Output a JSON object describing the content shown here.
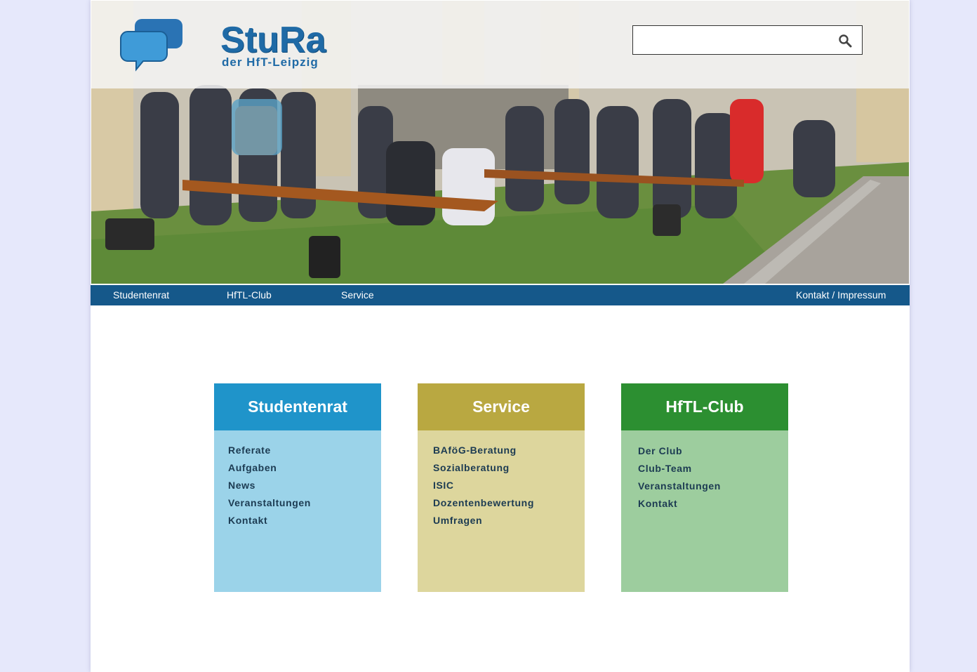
{
  "colors": {
    "page_background": "#e6e8fb",
    "nav_background": "#15588a",
    "studentenrat_head": "#1f94ca",
    "studentenrat_body": "#9bd3e9",
    "service_head": "#b9a841",
    "service_body": "#ddd69d",
    "club_head": "#2c8f31",
    "club_body": "#9dcd9e",
    "logo_blue": "#1f6aa6"
  },
  "header": {
    "logo_main": "StuRa",
    "logo_sub": "der HfT-Leipzig",
    "logo_icon": "speech-bubbles-icon",
    "search_value": "",
    "search_icon": "magnifier-icon"
  },
  "nav": {
    "items": [
      "Studentenrat",
      "HfTL-Club",
      "Service"
    ],
    "right": "Kontakt / Impressum"
  },
  "boxes": [
    {
      "title": "Studentenrat",
      "links": [
        "Referate",
        "Aufgaben",
        "News",
        "Veranstaltungen",
        "Kontakt"
      ]
    },
    {
      "title": "Service",
      "links": [
        "BAföG-Beratung",
        "Sozialberatung",
        "ISIC",
        "Dozentenbewertung",
        "Umfragen"
      ]
    },
    {
      "title": "HfTL-Club",
      "links": [
        "Der Club",
        "Club-Team",
        "Veranstaltungen",
        "Kontakt"
      ]
    }
  ]
}
